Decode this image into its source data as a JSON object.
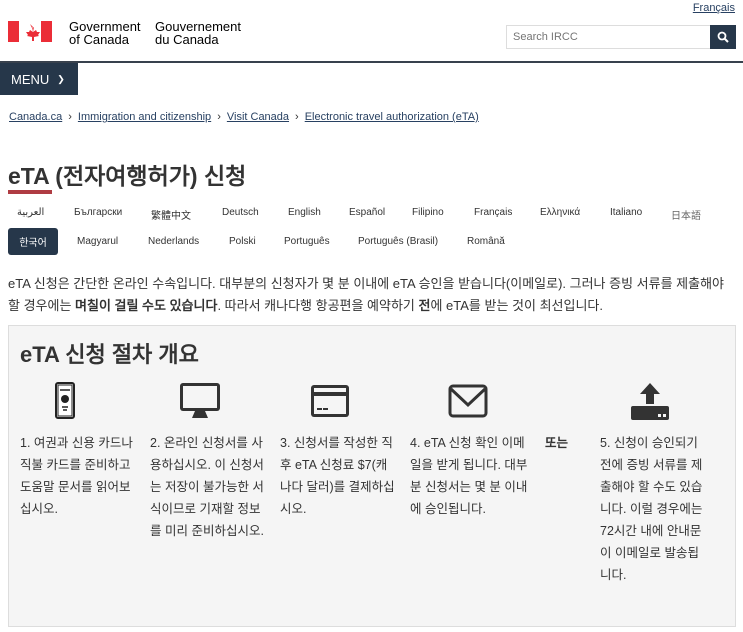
{
  "header": {
    "language_toggle": "Français",
    "gov_en_line1": "Government",
    "gov_en_line2": "of Canada",
    "gov_fr_line1": "Gouvernement",
    "gov_fr_line2": "du Canada",
    "search_placeholder": "Search IRCC",
    "menu_label": "MENU"
  },
  "breadcrumb": [
    "Canada.ca",
    "Immigration and citizenship",
    "Visit Canada",
    "Electronic travel authorization (eTA)"
  ],
  "page_title": "eTA (전자여행허가) 신청",
  "languages_row1": [
    "العربية",
    "Български",
    "繁體中文",
    "Deutsch",
    "English",
    "Español",
    "Filipino",
    "Français",
    "Ελληνικά",
    "Italiano",
    "日本語"
  ],
  "languages_row2": [
    "한국어",
    "Magyarul",
    "Nederlands",
    "Polski",
    "Português",
    "Português (Brasil)",
    "Română"
  ],
  "intro": {
    "p1": "eTA 신청은 간단한 온라인 수속입니다. 대부분의 신청자가 몇 분 이내에 eTA 승인을 받습니다(이메일로). 그러나 증빙 서류를 제출해야 할 경우에는 ",
    "b1": "며칠이 걸릴 수도 있습니다",
    "p2": ". 따라서 캐나다행 항공편을 예약하기 ",
    "b2": "전",
    "p3": "에 eTA를 받는 것이 최선입니다."
  },
  "overview": {
    "title": "eTA 신청 절차 개요",
    "or_label": "또는",
    "steps": [
      "1. 여권과 신용 카드나 직불 카드를 준비하고 도움말 문서를 읽어보십시오.",
      "2. 온라인 신청서를 사용하십시오. 이 신청서는 저장이 불가능한 서식이므로 기재할 정보를 미리 준비하십시오.",
      "3. 신청서를 작성한 직후 eTA 신청료 $7(캐나다 달러)를 결제하십시오.",
      "4. eTA 신청 확인 이메일을 받게 됩니다. 대부분 신청서는 몇 분 이내에 승인됩니다.",
      "5. 신청이 승인되기 전에 증빙 서류를 제출해야 할 수도 있습니다. 이럴 경우에는 72시간 내에 안내문이 이메일로 발송됩니다."
    ]
  }
}
